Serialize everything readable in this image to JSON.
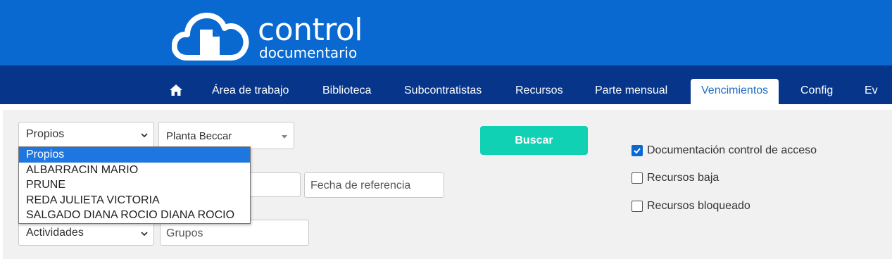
{
  "brand": {
    "word1": "control",
    "word2": "documentario"
  },
  "nav": {
    "items": [
      {
        "label": "Área de trabajo"
      },
      {
        "label": "Biblioteca"
      },
      {
        "label": "Subcontratistas"
      },
      {
        "label": "Recursos"
      },
      {
        "label": "Parte mensual"
      },
      {
        "label": "Vencimientos"
      },
      {
        "label": "Config"
      },
      {
        "label": "Ev"
      }
    ],
    "active": "Vencimientos"
  },
  "filters": {
    "owner_select": "Propios",
    "site_select": "Planta Beccar",
    "date_placeholder": "Fecha de referencia",
    "activities_select": "Actividades",
    "groups_placeholder": "Grupos",
    "search_button": "Buscar"
  },
  "owner_dropdown": {
    "options": [
      "Propios",
      "ALBARRACIN MARIO",
      "PRUNE",
      "REDA JULIETA VICTORIA",
      "SALGADO DIANA ROCIO DIANA ROCIO"
    ],
    "selected_index": 0
  },
  "checkboxes": [
    {
      "label": "Documentación control de acceso",
      "checked": true
    },
    {
      "label": "Recursos baja",
      "checked": false
    },
    {
      "label": "Recursos bloqueado",
      "checked": false
    }
  ],
  "colors": {
    "header": "#0969d1",
    "nav": "#07358a",
    "accent": "#11d1b4",
    "selection": "#1e77e0"
  }
}
